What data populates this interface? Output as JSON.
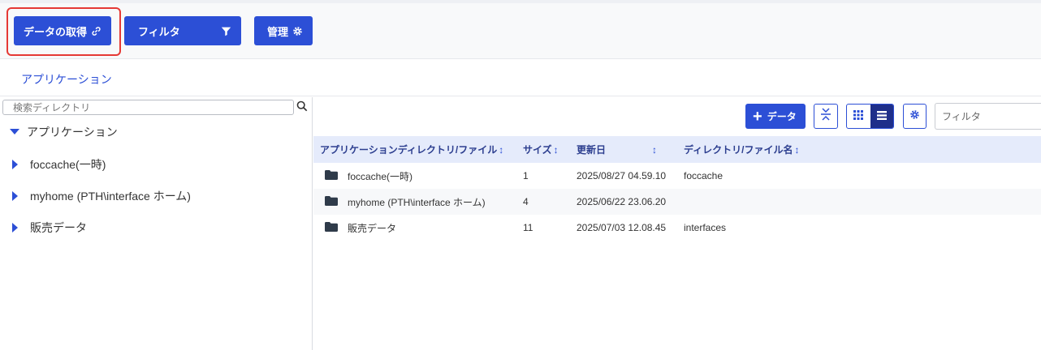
{
  "toolbar": {
    "get_data_label": "データの取得",
    "filter_label": "フィルタ",
    "manage_label": "管理"
  },
  "breadcrumb": {
    "current": "アプリケーション"
  },
  "tree": {
    "search_placeholder": "検索ディレクトリ",
    "root": "アプリケーション",
    "items": [
      {
        "label": "foccache(一時)"
      },
      {
        "label": "myhome (PTH\\interface ホーム)"
      },
      {
        "label": "販売データ"
      }
    ]
  },
  "list": {
    "add_data_label": "データ",
    "filter_placeholder": "フィルタ",
    "columns": [
      "アプリケーションディレクトリ/ファイル",
      "サイズ",
      "更新日",
      "ディレクトリ/ファイル名"
    ],
    "rows": [
      {
        "name": "foccache(一時)",
        "size": "1",
        "updated": "2025/08/27 04.59.10",
        "dirname": "foccache"
      },
      {
        "name": "myhome (PTH\\interface ホーム)",
        "size": "4",
        "updated": "2025/06/22 23.06.20",
        "dirname": ""
      },
      {
        "name": "販売データ",
        "size": "11",
        "updated": "2025/07/03 12.08.45",
        "dirname": "interfaces"
      }
    ]
  },
  "colors": {
    "accent": "#2c4fd6",
    "accent_dark": "#1f2f8a",
    "header_bg": "#e5ebfb",
    "highlight": "#e53935"
  }
}
